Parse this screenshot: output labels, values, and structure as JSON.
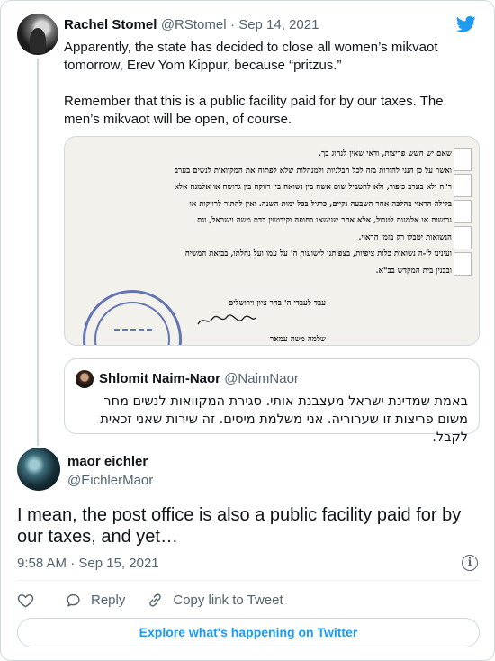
{
  "tweet": {
    "author_name": "Rachel Stomel",
    "author_handle": "@RStomel",
    "date": "Sep 14, 2021",
    "text_p1": "Apparently, the state has decided to close all women’s mikvaot tomorrow, Erev Yom Kippur, because “pritzus.”",
    "text_p2": "Remember that this is a public facility paid for by our taxes. The men’s mikvaot will be open, of course."
  },
  "document_image": {
    "lines": [
      "שאם יש חשש פריצות, ודאי שאין לנהוג כך.",
      "ואשר על כן הנני להורות בזה לכל הבלניות ולמנהלות שלא לפתוח את המקוואות לנשים בערב",
      "ר\"ה ולא בערב כיפור, ולא להטביל שום אשה בין נשואה בין רווקה בין גרושה או אלמנה אלא",
      "בלילה הראוי בהלכה אחר השבעה נקיים, כרגיל בכל ימות השנה. ואין להתיר לרווקות או",
      "גרושות או אלמנות לטבול, אלא אחר שנישאו בחופה וקידושין כדת משה וישראל, וגם",
      "הנשואות יטבלו רק בזמן הראוי.",
      "ועינינו לי-ה נשואות כלות ציפיות, בצפיתנו לישועות ה' על עמו ועל נחלתו, בביאת המשיח",
      "ובבנין בית המקדש בב\"א."
    ],
    "signature_line1": "עבד לעבדי ה' בהר ציון וירושלים",
    "signature_line2": "שלמה משה עמאר"
  },
  "quoted_tweet": {
    "author_name": "Shlomit Naim-Naor",
    "author_handle": "@NaimNaor",
    "text": "באמת שמדינת ישראל מעצבנת אותי. סגירת המקוואות לנשים מחר משום פריצות זו שערוריה. אני משלמת מיסים. זה שירות שאני זכאית לקבל."
  },
  "reply": {
    "author_name": "maor eichler",
    "author_handle": "@EichlerMaor",
    "text": "I mean, the post office is also a public facility paid for by our taxes, and yet…",
    "time": "9:58 AM",
    "date": "Sep 15, 2021"
  },
  "actions": {
    "reply_label": "Reply",
    "copy_link_label": "Copy link to Tweet"
  },
  "explore_label": "Explore what's happening on Twitter",
  "icons": [
    "twitter-bird-icon",
    "info-icon",
    "heart-icon",
    "reply-icon",
    "link-icon"
  ],
  "colors": {
    "accent": "#1d9bf0",
    "secondary_text": "#536471",
    "border": "#cfd9de"
  }
}
